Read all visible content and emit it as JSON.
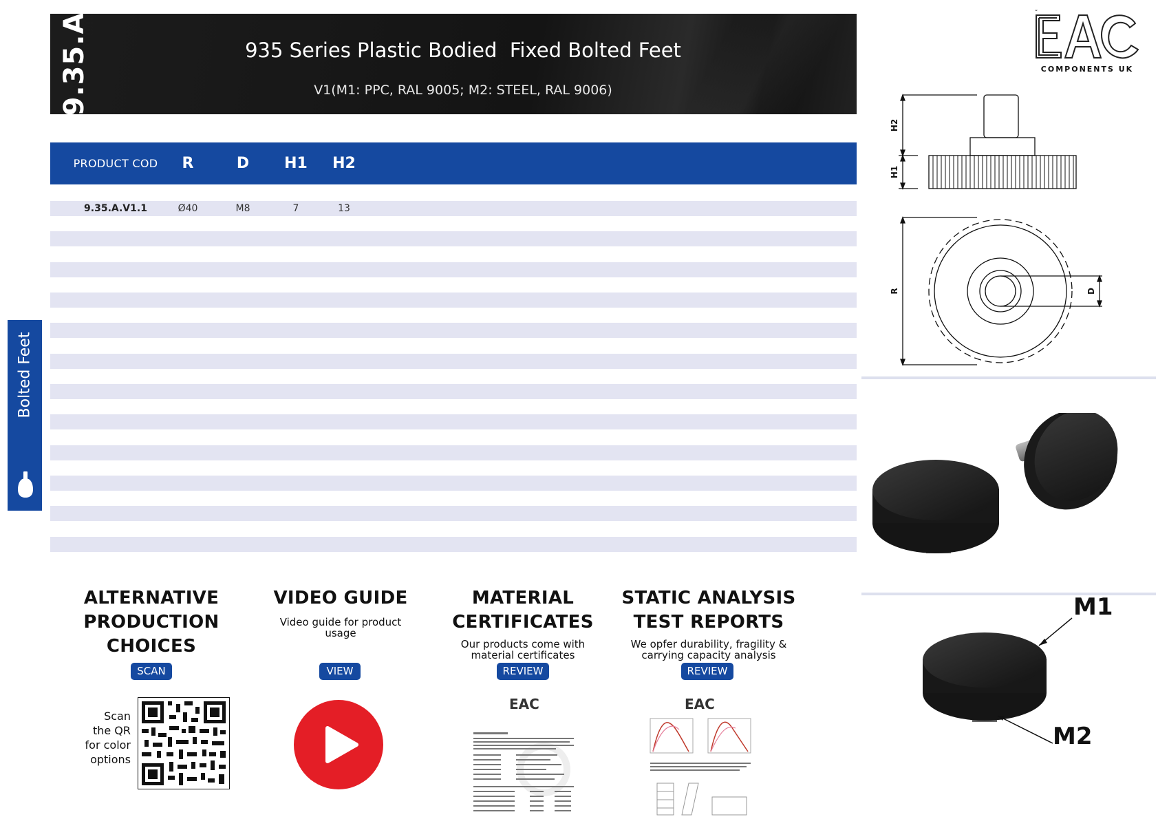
{
  "header": {
    "code": "9.35.A",
    "title": "935 Series Plastic Bodied  Fixed Bolted Feet",
    "subtitle": "V1(M1: PPC, RAL 9005; M2: STEEL, RAL 9006)"
  },
  "table": {
    "columns": [
      "PRODUCT COD",
      "R",
      "D",
      "H1",
      "H2"
    ],
    "rows": [
      [
        "9.35.A.V1.1",
        "Ø40",
        "M8",
        "7",
        "13"
      ]
    ]
  },
  "side_tab": {
    "label": "Bolted Feet",
    "icon": "foot-icon"
  },
  "logo": {
    "text": "EAC",
    "subtitle": "COMPONENTS UK"
  },
  "drawing_labels": {
    "h2": "H2",
    "h1": "H1",
    "r": "R",
    "d": "D"
  },
  "material_labels": {
    "m1": "M1",
    "m2": "M2"
  },
  "bottom": {
    "alternative": {
      "title": [
        "ALTERNATIVE",
        "PRODUCTION",
        "CHOICES"
      ],
      "button": "SCAN",
      "scan_text": [
        "Scan",
        "the QR",
        "for color",
        "options"
      ]
    },
    "video": {
      "title": [
        "VIDEO GUIDE"
      ],
      "desc": [
        "Video guide for product",
        "usage"
      ],
      "button": "VIEW"
    },
    "certificates": {
      "title": [
        "MATERIAL",
        "CERTIFICATES"
      ],
      "desc": [
        "Our products come with",
        "material certificates"
      ],
      "button": "REVIEW"
    },
    "analysis": {
      "title": [
        "STATIC ANALYSIS",
        "TEST REPORTS"
      ],
      "desc": [
        "We opfer durability, fragility &",
        "carrying capacity analysis"
      ],
      "button": "REVIEW"
    }
  },
  "colors": {
    "brand_blue": "#1549a0",
    "stripe": "#e3e4f2",
    "header_black": "#151515",
    "play_red": "#e41e26"
  }
}
